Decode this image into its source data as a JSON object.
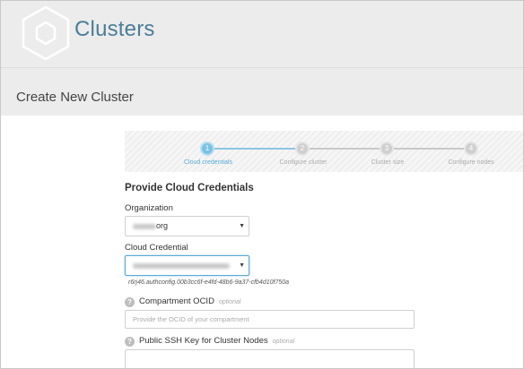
{
  "header": {
    "app_title": "Clusters",
    "logo_icon": "hexagon-cube-icon"
  },
  "page": {
    "title": "Create New Cluster"
  },
  "stepper": {
    "steps": [
      {
        "number": "1",
        "label": "Cloud credentials",
        "active": true
      },
      {
        "number": "2",
        "label": "Configure cluster",
        "active": false
      },
      {
        "number": "3",
        "label": "Cluster size",
        "active": false
      },
      {
        "number": "4",
        "label": "Configure nodes",
        "active": false
      }
    ]
  },
  "form": {
    "section_title": "Provide Cloud Credentials",
    "organization": {
      "label": "Organization",
      "value_suffix": "org"
    },
    "cloud_credential": {
      "label": "Cloud Credential",
      "hint": "r6rj46.authconfig.00b3cc6f-e4fd-48b6-9a37-cfb4d10f750a"
    },
    "compartment": {
      "label": "Compartment OCID",
      "optional": "optional",
      "placeholder": "Provide the OCID of your compartment"
    },
    "ssh_key": {
      "label": "Public SSH Key for Cluster Nodes",
      "optional": "optional"
    },
    "help_icon": "question-mark-icon"
  },
  "colors": {
    "accent": "#7cc1e4",
    "title_blue": "#4b7d98",
    "header_bg": "#ececec"
  }
}
